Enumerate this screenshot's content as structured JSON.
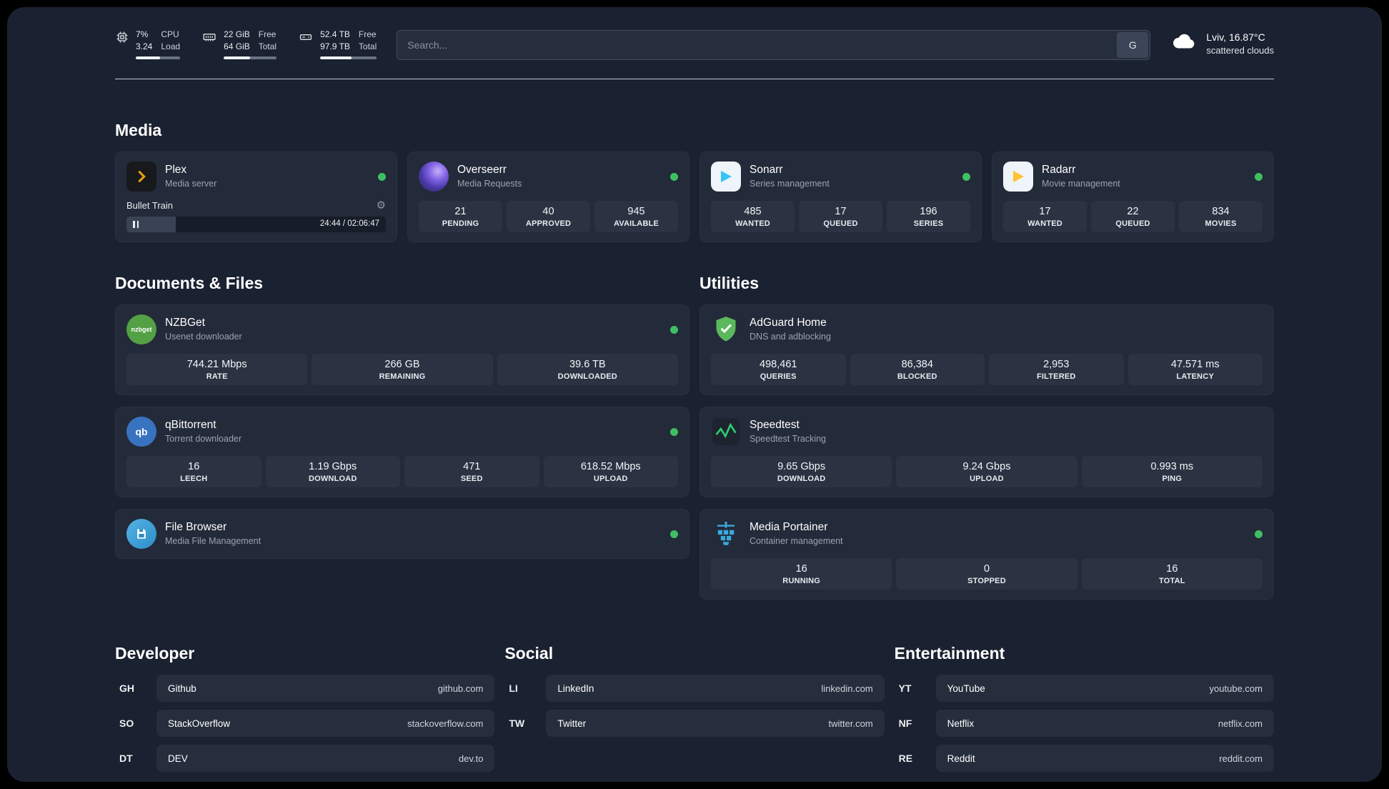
{
  "icons": {
    "gear": "⚙"
  },
  "topbar": {
    "metrics": [
      {
        "top_value": "7%",
        "bottom_value": "3.24",
        "top_label": "CPU",
        "bottom_label": "Load",
        "bar": 55
      },
      {
        "top_value": "22 GiB",
        "bottom_value": "64 GiB",
        "top_label": "Free",
        "bottom_label": "Total",
        "bar": 50
      },
      {
        "top_value": "52.4 TB",
        "bottom_value": "97.9 TB",
        "top_label": "Free",
        "bottom_label": "Total",
        "bar": 55
      }
    ],
    "search": {
      "placeholder": "Search...",
      "engine": "G"
    },
    "weather": {
      "location": "Lviv, 16.87°C",
      "condition": "scattered clouds"
    }
  },
  "sections": {
    "media": "Media",
    "documents": "Documents & Files",
    "utilities": "Utilities"
  },
  "apps": {
    "plex": {
      "name": "Plex",
      "subtitle": "Media server",
      "now_playing": "Bullet Train",
      "time": "24:44 / 02:06:47",
      "progress": 19
    },
    "overseerr": {
      "name": "Overseerr",
      "subtitle": "Media Requests",
      "stats": [
        {
          "value": "21",
          "label": "PENDING"
        },
        {
          "value": "40",
          "label": "APPROVED"
        },
        {
          "value": "945",
          "label": "AVAILABLE"
        }
      ]
    },
    "sonarr": {
      "name": "Sonarr",
      "subtitle": "Series management",
      "stats": [
        {
          "value": "485",
          "label": "WANTED"
        },
        {
          "value": "17",
          "label": "QUEUED"
        },
        {
          "value": "196",
          "label": "SERIES"
        }
      ]
    },
    "radarr": {
      "name": "Radarr",
      "subtitle": "Movie management",
      "stats": [
        {
          "value": "17",
          "label": "WANTED"
        },
        {
          "value": "22",
          "label": "QUEUED"
        },
        {
          "value": "834",
          "label": "MOVIES"
        }
      ]
    },
    "nzbget": {
      "name": "NZBGet",
      "subtitle": "Usenet downloader",
      "icon_text": "nzbget",
      "stats": [
        {
          "value": "744.21 Mbps",
          "label": "RATE"
        },
        {
          "value": "266 GB",
          "label": "REMAINING"
        },
        {
          "value": "39.6 TB",
          "label": "DOWNLOADED"
        }
      ]
    },
    "qbittorrent": {
      "name": "qBittorrent",
      "subtitle": "Torrent downloader",
      "icon_text": "qb",
      "stats": [
        {
          "value": "16",
          "label": "LEECH"
        },
        {
          "value": "1.19 Gbps",
          "label": "DOWNLOAD"
        },
        {
          "value": "471",
          "label": "SEED"
        },
        {
          "value": "618.52 Mbps",
          "label": "UPLOAD"
        }
      ]
    },
    "filebrowser": {
      "name": "File Browser",
      "subtitle": "Media File Management"
    },
    "adguard": {
      "name": "AdGuard Home",
      "subtitle": "DNS and adblocking",
      "stats": [
        {
          "value": "498,461",
          "label": "QUERIES"
        },
        {
          "value": "86,384",
          "label": "BLOCKED"
        },
        {
          "value": "2,953",
          "label": "FILTERED"
        },
        {
          "value": "47.571 ms",
          "label": "LATENCY"
        }
      ]
    },
    "speedtest": {
      "name": "Speedtest",
      "subtitle": "Speedtest Tracking",
      "stats": [
        {
          "value": "9.65 Gbps",
          "label": "DOWNLOAD"
        },
        {
          "value": "9.24 Gbps",
          "label": "UPLOAD"
        },
        {
          "value": "0.993 ms",
          "label": "PING"
        }
      ]
    },
    "portainer": {
      "name": "Media Portainer",
      "subtitle": "Container management",
      "stats": [
        {
          "value": "16",
          "label": "RUNNING"
        },
        {
          "value": "0",
          "label": "STOPPED"
        },
        {
          "value": "16",
          "label": "TOTAL"
        }
      ]
    }
  },
  "bookmarks": {
    "developer": {
      "title": "Developer",
      "items": [
        {
          "abbr": "GH",
          "name": "Github",
          "url": "github.com"
        },
        {
          "abbr": "SO",
          "name": "StackOverflow",
          "url": "stackoverflow.com"
        },
        {
          "abbr": "DT",
          "name": "DEV",
          "url": "dev.to"
        }
      ]
    },
    "social": {
      "title": "Social",
      "items": [
        {
          "abbr": "LI",
          "name": "LinkedIn",
          "url": "linkedin.com"
        },
        {
          "abbr": "TW",
          "name": "Twitter",
          "url": "twitter.com"
        }
      ]
    },
    "entertainment": {
      "title": "Entertainment",
      "items": [
        {
          "abbr": "YT",
          "name": "YouTube",
          "url": "youtube.com"
        },
        {
          "abbr": "NF",
          "name": "Netflix",
          "url": "netflix.com"
        },
        {
          "abbr": "RE",
          "name": "Reddit",
          "url": "reddit.com"
        }
      ]
    }
  }
}
